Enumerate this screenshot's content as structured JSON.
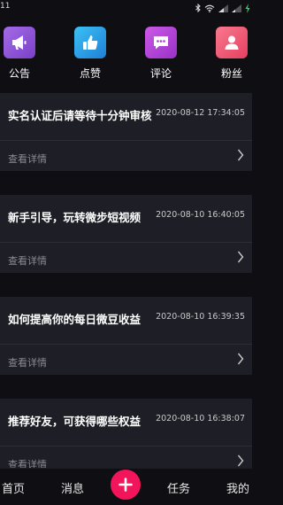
{
  "status_bar": {
    "time": "11"
  },
  "shortcuts": [
    {
      "label": "公告",
      "icon": "megaphone-icon",
      "color": "#8f55d6"
    },
    {
      "label": "点赞",
      "icon": "thumbs-up-icon",
      "color": "#2aa3e6"
    },
    {
      "label": "评论",
      "icon": "comment-icon",
      "color": "#b03fd1"
    },
    {
      "label": "粉丝",
      "icon": "fans-icon",
      "color": "#ef5476"
    }
  ],
  "messages": [
    {
      "title": "实名认证后请等待十分钟审核",
      "time": "2020-08-12 17:34:05",
      "link": "查看详情"
    },
    {
      "title": "新手引导，玩转微步短视频",
      "time": "2020-08-10 16:40:05",
      "link": "查看详情"
    },
    {
      "title": "如何提高你的每日微豆收益",
      "time": "2020-08-10 16:39:35",
      "link": "查看详情"
    },
    {
      "title": "推荐好友，可获得哪些权益",
      "time": "2020-08-10 16:38:07",
      "link": "查看详情"
    }
  ],
  "tabbar": {
    "home": "首页",
    "messages": "消息",
    "tasks": "任务",
    "mine": "我的",
    "accent": "#f3155c"
  }
}
